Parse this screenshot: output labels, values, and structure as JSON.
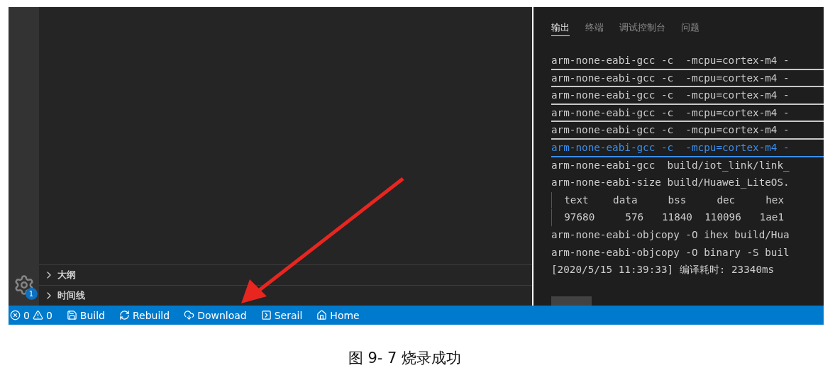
{
  "sidebar": {
    "sections": [
      {
        "label": "大纲",
        "expanded": false
      },
      {
        "label": "时间线",
        "expanded": false
      }
    ]
  },
  "activity_bar": {
    "settings_badge": "1"
  },
  "panel": {
    "tabs": [
      {
        "label": "输出",
        "selected": true
      },
      {
        "label": "终端",
        "selected": false
      },
      {
        "label": "调试控制台",
        "selected": false
      },
      {
        "label": "问题",
        "selected": false
      }
    ],
    "lines": [
      {
        "text": "arm-none-eabi-gcc -c  -mcpu=cortex-m4 -",
        "kind": "underlined"
      },
      {
        "text": "arm-none-eabi-gcc -c  -mcpu=cortex-m4 -",
        "kind": "underlined"
      },
      {
        "text": "arm-none-eabi-gcc -c  -mcpu=cortex-m4 -",
        "kind": "underlined"
      },
      {
        "text": "arm-none-eabi-gcc -c  -mcpu=cortex-m4 -",
        "kind": "underlined"
      },
      {
        "text": "arm-none-eabi-gcc -c  -mcpu=cortex-m4 -",
        "kind": "underlined"
      },
      {
        "text": "arm-none-eabi-gcc -c  -mcpu=cortex-m4 -",
        "kind": "link"
      },
      {
        "text": "arm-none-eabi-gcc  build/iot_link/link_",
        "kind": "plain"
      },
      {
        "text": "arm-none-eabi-size build/Huawei_LiteOS.",
        "kind": "plain"
      },
      {
        "text": "  text    data     bss     dec     hex",
        "kind": "table"
      },
      {
        "text": "  97680     576   11840  110096   1ae1",
        "kind": "table"
      },
      {
        "text": "arm-none-eabi-objcopy -O ihex build/Hua",
        "kind": "plain"
      },
      {
        "text": "arm-none-eabi-objcopy -O binary -S buil",
        "kind": "plain"
      },
      {
        "text": "[2020/5/15 11:39:33] 编译耗时: 23340ms",
        "kind": "plain"
      }
    ]
  },
  "status_bar": {
    "errors": "0",
    "warnings": "0",
    "items": [
      {
        "label": "Build",
        "kind": "build"
      },
      {
        "label": "Rebuild",
        "kind": "rebuild"
      },
      {
        "label": "Download",
        "kind": "download"
      },
      {
        "label": "Serail",
        "kind": "serial"
      },
      {
        "label": "Home",
        "kind": "home"
      }
    ]
  },
  "caption": "图  9- 7 烧录成功"
}
